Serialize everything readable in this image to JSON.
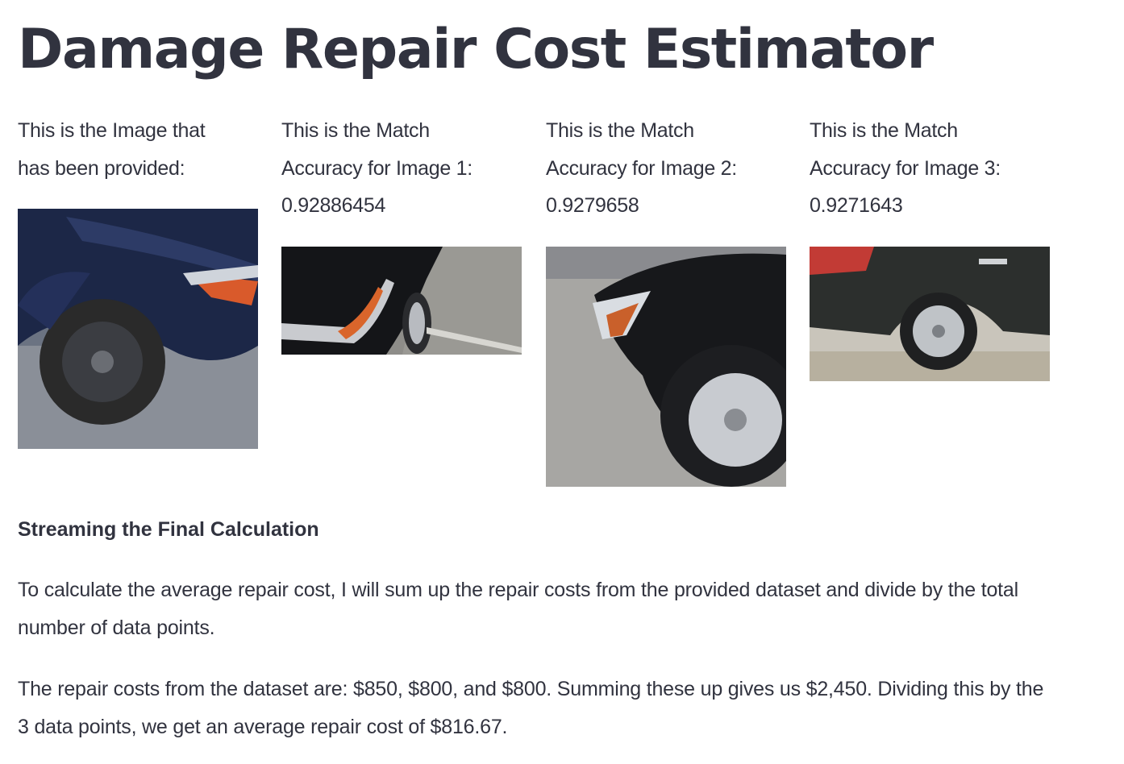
{
  "page": {
    "title": "Damage Repair Cost Estimator"
  },
  "columns": [
    {
      "caption_lines": [
        "This is the Image that",
        "has been provided:"
      ],
      "image": "provided-car-damage-image"
    },
    {
      "caption_lines": [
        "This is the Match",
        "Accuracy for Image 1:",
        "0.92886454"
      ],
      "image": "match-image-1"
    },
    {
      "caption_lines": [
        "This is the Match",
        "Accuracy for Image 2:",
        "0.9279658"
      ],
      "image": "match-image-2"
    },
    {
      "caption_lines": [
        "This is the Match",
        "Accuracy for Image 3:",
        "0.9271643"
      ],
      "image": "match-image-3"
    }
  ],
  "calculation": {
    "heading": "Streaming the Final Calculation",
    "paragraph_1": "To calculate the average repair cost, I will sum up the repair costs from the provided dataset and divide by the total number of data points.",
    "paragraph_2": "The repair costs from the dataset are: $850, $800, and $800. Summing these up gives us $2,450. Dividing this by the 3 data points, we get an average repair cost of $816.67."
  }
}
